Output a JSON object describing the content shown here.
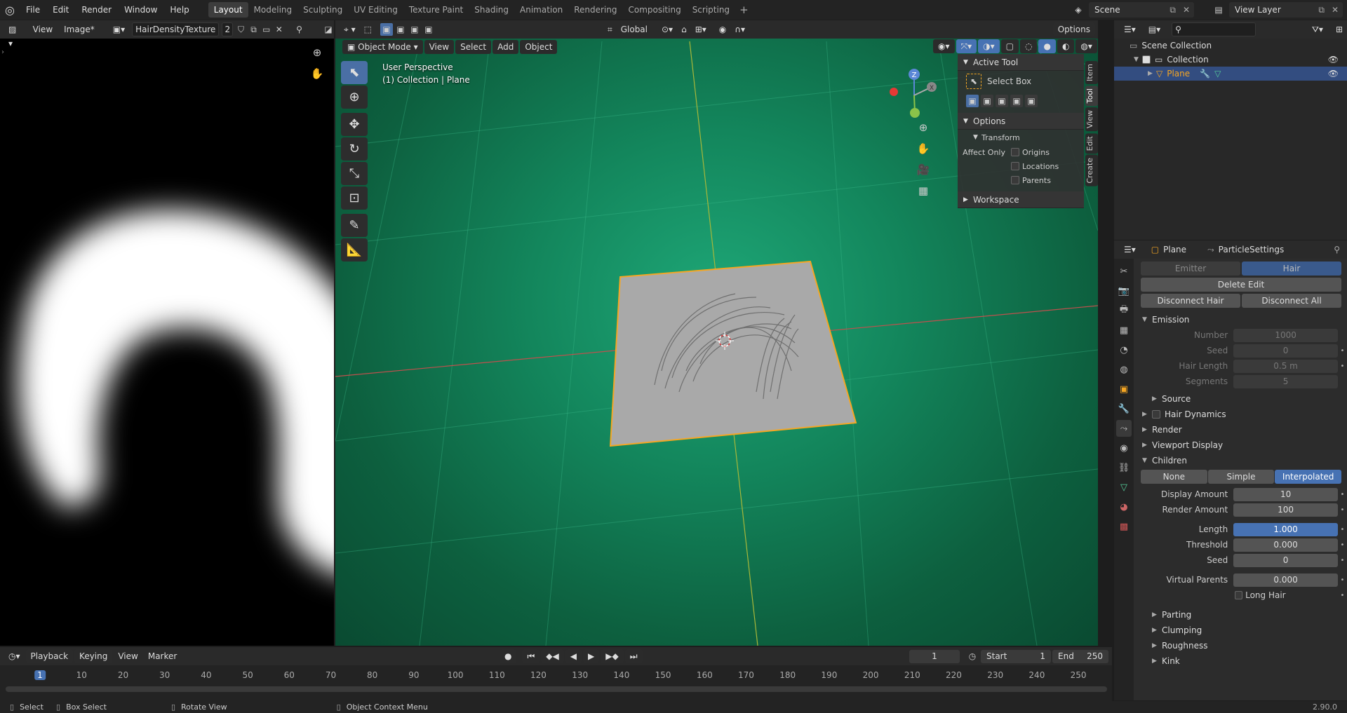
{
  "topbar": {
    "menus": [
      "File",
      "Edit",
      "Render",
      "Window",
      "Help"
    ],
    "workspaces": [
      "Layout",
      "Modeling",
      "Sculpting",
      "UV Editing",
      "Texture Paint",
      "Shading",
      "Animation",
      "Rendering",
      "Compositing",
      "Scripting"
    ],
    "active_workspace": "Layout",
    "add": "+",
    "scene": "Scene",
    "view_layer": "View Layer"
  },
  "image_editor": {
    "view": "View",
    "image_menu": "Image*",
    "image_name": "HairDensityTexture",
    "users": "2"
  },
  "viewport": {
    "orientation": "Global",
    "options": "Options",
    "mode": "Object Mode",
    "menus": [
      "View",
      "Select",
      "Add",
      "Object"
    ],
    "overlay_line1": "User Perspective",
    "overlay_line2": "(1) Collection | Plane",
    "gizmo": {
      "z": "Z",
      "y": "Y",
      "x": "X"
    },
    "npanel": {
      "active_tool": "Active Tool",
      "select_box": "Select Box",
      "options": "Options",
      "transform": "Transform",
      "affect_only": "Affect Only",
      "origins": "Origins",
      "locations": "Locations",
      "parents": "Parents",
      "workspace": "Workspace"
    },
    "tabs": [
      "Item",
      "Tool",
      "View",
      "Edit",
      "Create"
    ],
    "active_tab": "Tool"
  },
  "outliner": {
    "scene_collection": "Scene Collection",
    "collection": "Collection",
    "plane": "Plane"
  },
  "properties": {
    "object": "Plane",
    "settings": "ParticleSettings",
    "type_buttons": [
      "Emitter",
      "Hair"
    ],
    "delete_edit": "Delete Edit",
    "disconnect_hair": "Disconnect Hair",
    "disconnect_all": "Disconnect All",
    "emission": {
      "title": "Emission",
      "rows": [
        {
          "label": "Number",
          "value": "1000"
        },
        {
          "label": "Seed",
          "value": "0"
        },
        {
          "label": "Hair Length",
          "value": "0.5 m"
        },
        {
          "label": "Segments",
          "value": "5"
        }
      ],
      "source": "Source"
    },
    "sections": [
      "Hair Dynamics",
      "Render",
      "Viewport Display"
    ],
    "children": {
      "title": "Children",
      "modes": [
        "None",
        "Simple",
        "Interpolated"
      ],
      "active_mode": "Interpolated",
      "display_amount": {
        "label": "Display Amount",
        "value": "10"
      },
      "render_amount": {
        "label": "Render Amount",
        "value": "100"
      },
      "length": {
        "label": "Length",
        "value": "1.000"
      },
      "threshold": {
        "label": "Threshold",
        "value": "0.000"
      },
      "seed": {
        "label": "Seed",
        "value": "0"
      },
      "virtual_parents": {
        "label": "Virtual Parents",
        "value": "0.000"
      },
      "long_hair": "Long Hair"
    },
    "subsections": [
      "Parting",
      "Clumping",
      "Roughness",
      "Kink"
    ]
  },
  "timeline": {
    "menus": [
      "Playback",
      "Keying",
      "View",
      "Marker"
    ],
    "current_frame": "1",
    "start_label": "Start",
    "start": "1",
    "end_label": "End",
    "end": "250",
    "ticks": [
      "1",
      "10",
      "20",
      "30",
      "40",
      "50",
      "60",
      "70",
      "80",
      "90",
      "100",
      "110",
      "120",
      "130",
      "140",
      "150",
      "160",
      "170",
      "180",
      "190",
      "200",
      "210",
      "220",
      "230",
      "240",
      "250"
    ]
  },
  "statusbar": {
    "select": "Select",
    "box_select": "Box Select",
    "rotate_view": "Rotate View",
    "context_menu": "Object Context Menu",
    "version": "2.90.0"
  },
  "colors": {
    "accent": "#4772b3",
    "selection": "#f5a623",
    "viewport_bg": "#13865c"
  }
}
